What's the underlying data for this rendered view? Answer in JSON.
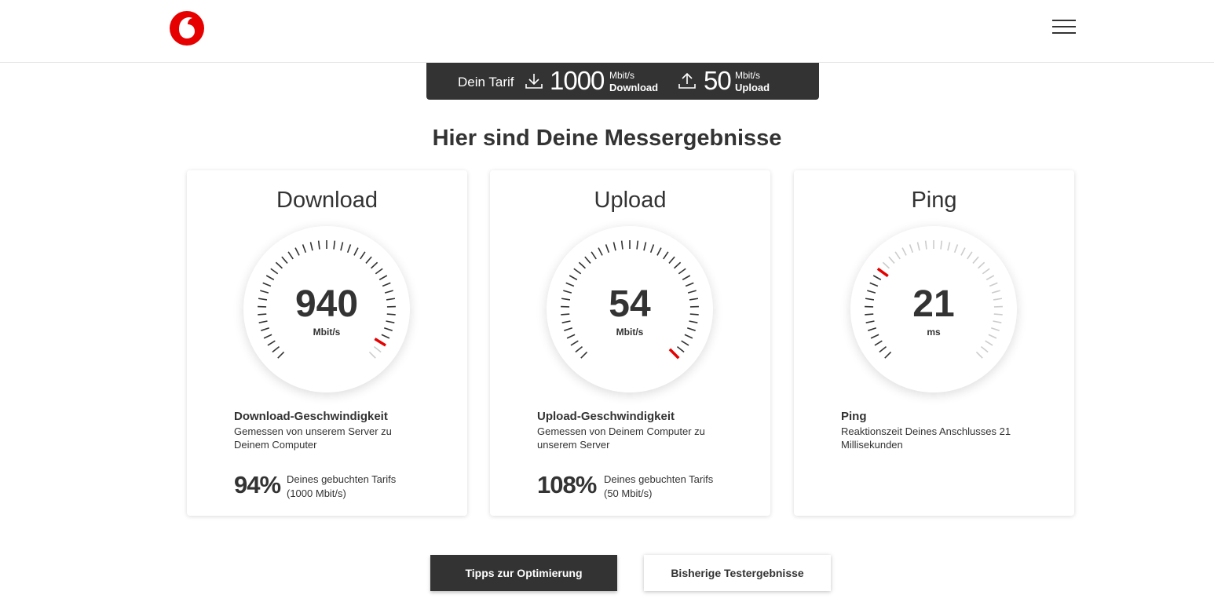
{
  "header": {
    "logo_icon": "vodafone-logo",
    "menu_icon": "hamburger-menu-icon"
  },
  "tariff": {
    "label": "Dein Tarif",
    "download": {
      "icon": "download-icon",
      "value": "1000",
      "unit": "Mbit/s",
      "label": "Download"
    },
    "upload": {
      "icon": "upload-icon",
      "value": "50",
      "unit": "Mbit/s",
      "label": "Upload"
    }
  },
  "title": "Hier sind Deine Messergebnisse",
  "cards": [
    {
      "heading": "Download",
      "value": "940",
      "unit": "Mbit/s",
      "desc_title": "Download-Geschwindigkeit",
      "desc_text": "Gemessen von unserem Server zu Deinem Computer",
      "percent": "94%",
      "percent_label": "Deines gebuchten Tarifs",
      "percent_sub": "(1000 Mbit/s)",
      "gauge_level": 0.94
    },
    {
      "heading": "Upload",
      "value": "54",
      "unit": "Mbit/s",
      "desc_title": "Upload-Geschwindigkeit",
      "desc_text": "Gemessen von Deinem Computer zu unserem Server",
      "percent": "108%",
      "percent_label": "Deines gebuchten Tarifs",
      "percent_sub": "(50 Mbit/s)",
      "gauge_level": 1.0
    },
    {
      "heading": "Ping",
      "value": "21",
      "unit": "ms",
      "desc_title": "Ping",
      "desc_text": "Reaktionszeit Deines Anschlusses 21 Millisekunden",
      "gauge_level": 0.3
    }
  ],
  "buttons": {
    "tips": "Tipps zur Optimierung",
    "history": "Bisherige Testergebnisse"
  },
  "colors": {
    "accent": "#e60000",
    "dark": "#333333",
    "tick_inactive": "#cccccc"
  }
}
